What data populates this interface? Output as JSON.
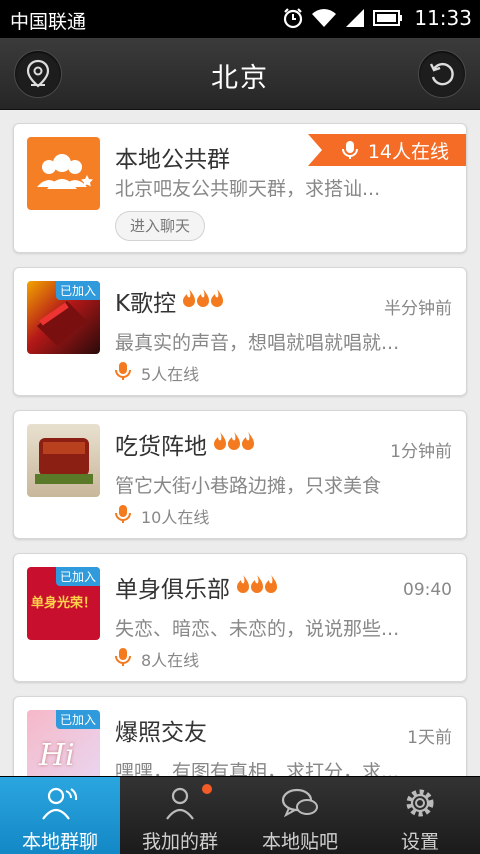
{
  "status_bar": {
    "carrier": "中国联通",
    "time": "11:33"
  },
  "header": {
    "title": "北京"
  },
  "public_group": {
    "name": "本地公共群",
    "online": "14人在线",
    "desc": "北京吧友公共聊天群，求搭讪...",
    "enter_label": "进入聊天"
  },
  "groups": [
    {
      "name": "K歌控",
      "time": "半分钟前",
      "desc": "最真实的声音，想唱就唱就唱就...",
      "online": "5人在线",
      "joined": "已加入"
    },
    {
      "name": "吃货阵地",
      "time": "1分钟前",
      "desc": "管它大街小巷路边摊，只求美食",
      "online": "10人在线",
      "joined": ""
    },
    {
      "name": "单身俱乐部",
      "time": "09:40",
      "desc": "失恋、暗恋、未恋的，说说那些...",
      "online": "8人在线",
      "joined": "已加入",
      "avatar_text": "单身光荣！"
    },
    {
      "name": "爆照交友",
      "time": "1天前",
      "desc": "嘿嘿，有图有真相，求打分，求...",
      "online": "",
      "joined": "已加入",
      "avatar_text": "Hi"
    }
  ],
  "bottom_nav": [
    {
      "label": "本地群聊",
      "icon": "group-chat-icon",
      "active": true
    },
    {
      "label": "我加的群",
      "icon": "my-groups-icon",
      "active": false,
      "dot": true
    },
    {
      "label": "本地贴吧",
      "icon": "forum-chat-icon",
      "active": false
    },
    {
      "label": "设置",
      "icon": "settings-gear-icon",
      "active": false
    }
  ],
  "colors": {
    "accent_orange": "#f46c26",
    "active_blue": "#1e98d6",
    "joined_blue": "#2f9bdc"
  }
}
